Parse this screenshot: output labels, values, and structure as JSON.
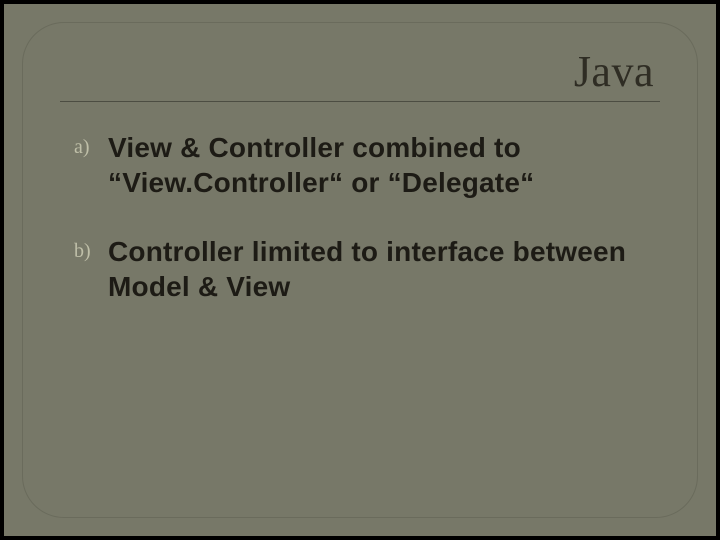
{
  "slide": {
    "title": "Java",
    "items": [
      {
        "marker": "a)",
        "text": "View & Controller combined to “View.Controller“ or “Delegate“"
      },
      {
        "marker": "b)",
        "text": "Controller limited to interface between Model & View"
      }
    ]
  }
}
